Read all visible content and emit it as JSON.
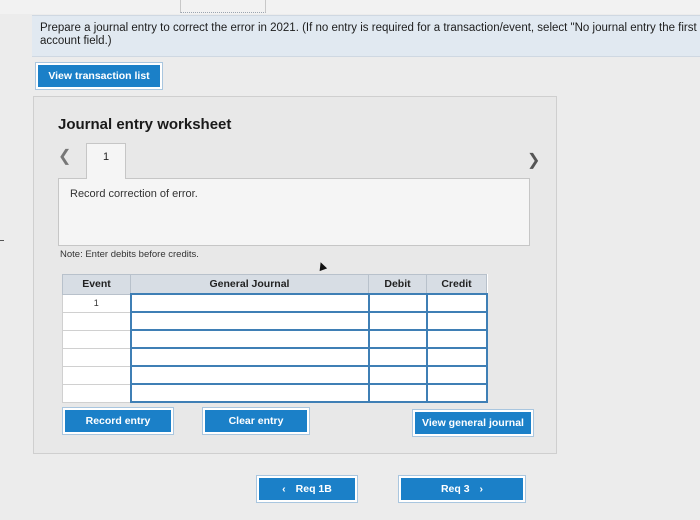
{
  "instruction": "Prepare a journal entry to correct the error in 2021. (If no entry is required for a transaction/event, select \"No journal entry the first account field.)",
  "buttons": {
    "view_transaction_list": "View transaction list",
    "record_entry": "Record entry",
    "clear_entry": "Clear entry",
    "view_general_journal": "View general journal",
    "prev_req": "Req 1B",
    "next_req": "Req 3"
  },
  "worksheet": {
    "title": "Journal entry worksheet",
    "tab_label": "1",
    "description": "Record correction of error.",
    "note": "Note: Enter debits before credits."
  },
  "table": {
    "headers": [
      "Event",
      "General Journal",
      "Debit",
      "Credit"
    ],
    "rows": [
      {
        "event": "1",
        "account": "",
        "debit": "",
        "credit": ""
      },
      {
        "event": "",
        "account": "",
        "debit": "",
        "credit": ""
      },
      {
        "event": "",
        "account": "",
        "debit": "",
        "credit": ""
      },
      {
        "event": "",
        "account": "",
        "debit": "",
        "credit": ""
      },
      {
        "event": "",
        "account": "",
        "debit": "",
        "credit": ""
      },
      {
        "event": "",
        "account": "",
        "debit": "",
        "credit": ""
      }
    ]
  },
  "icons": {
    "prev": "chevron-left-icon",
    "next": "chevron-right-icon"
  },
  "colors": {
    "button_blue": "#1b80c8",
    "instruction_bg": "#e1e9f1",
    "input_border": "#3f7fb5"
  }
}
